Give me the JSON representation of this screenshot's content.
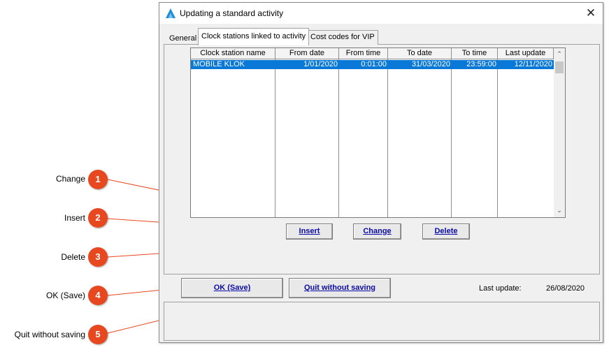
{
  "window": {
    "title": "Updating a standard activity",
    "close_glyph": "✕"
  },
  "tabs": [
    {
      "label": "General",
      "active": false
    },
    {
      "label": "Clock stations linked to activity",
      "active": true
    },
    {
      "label": "Cost codes for VIP",
      "active": false
    }
  ],
  "grid": {
    "columns": [
      "Clock station name",
      "From date",
      "From time",
      "To date",
      "To time",
      "Last update"
    ],
    "rows": [
      [
        "MOBILE KLOK",
        "1/01/2020",
        "0:01:00",
        "31/03/2020",
        "23:59:00",
        "12/11/2020"
      ]
    ],
    "selected_row": 0,
    "selection_color": "#0a78d7"
  },
  "buttons": {
    "insert": "Insert",
    "change": "Change",
    "delete": "Delete",
    "ok": "OK (Save)",
    "quit": "Quit without saving"
  },
  "footer": {
    "last_update_label": "Last update:",
    "last_update_value": "26/08/2020"
  },
  "callouts": [
    {
      "number": "1",
      "label": "Change"
    },
    {
      "number": "2",
      "label": "Insert"
    },
    {
      "number": "3",
      "label": "Delete"
    },
    {
      "number": "4",
      "label": "OK (Save)"
    },
    {
      "number": "5",
      "label": "Quit without saving"
    }
  ],
  "colors": {
    "accent_link": "#0a0aa8",
    "callout": "#e8481f",
    "app_icon": "#1e8fd6"
  }
}
